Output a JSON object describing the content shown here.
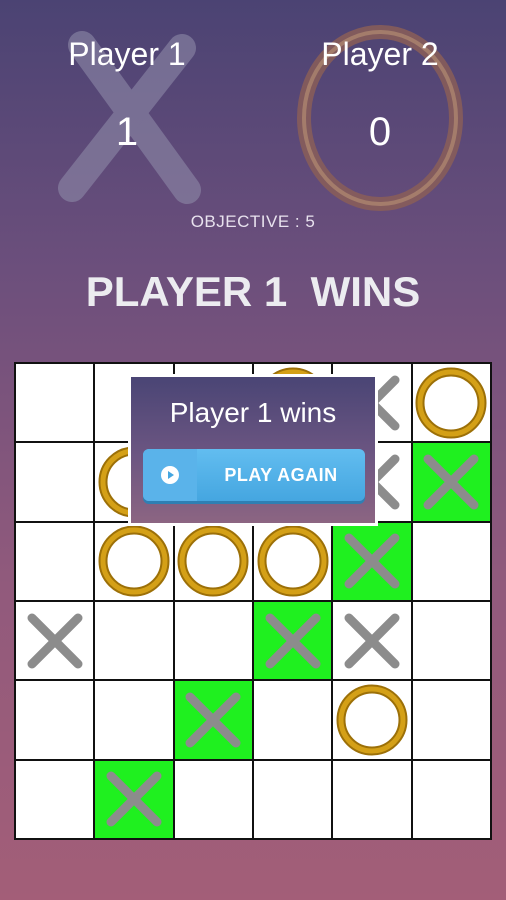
{
  "player1": {
    "name": "Player 1",
    "score": "1",
    "symbol": "x-icon"
  },
  "player2": {
    "name": "Player 2",
    "score": "0",
    "symbol": "o-icon"
  },
  "objective": "OBJECTIVE  :  5",
  "result": "PLAYER 1  WINS",
  "dialog": {
    "message": "Player 1 wins",
    "button_label": "PLAY AGAIN",
    "button_icon": "play-icon"
  },
  "board": {
    "rows": 6,
    "cols": 6,
    "cells": [
      [
        "",
        "",
        "",
        "O",
        "X",
        "O"
      ],
      [
        "",
        "O",
        "",
        "",
        "X",
        "X"
      ],
      [
        "",
        "O",
        "O",
        "O",
        "X",
        ""
      ],
      [
        "X",
        "",
        "",
        "X",
        "X",
        ""
      ],
      [
        "",
        "",
        "X",
        "",
        "O",
        ""
      ],
      [
        "",
        "X",
        "",
        "",
        "",
        ""
      ]
    ],
    "winning_line": [
      [
        5,
        1
      ],
      [
        4,
        2
      ],
      [
        3,
        3
      ],
      [
        2,
        4
      ],
      [
        1,
        5
      ]
    ]
  },
  "colors": {
    "win_highlight": "#1ff01f",
    "x_mark": "#8c8c8c",
    "o_mark": "#d4a017",
    "button": "#4aa9e2"
  }
}
